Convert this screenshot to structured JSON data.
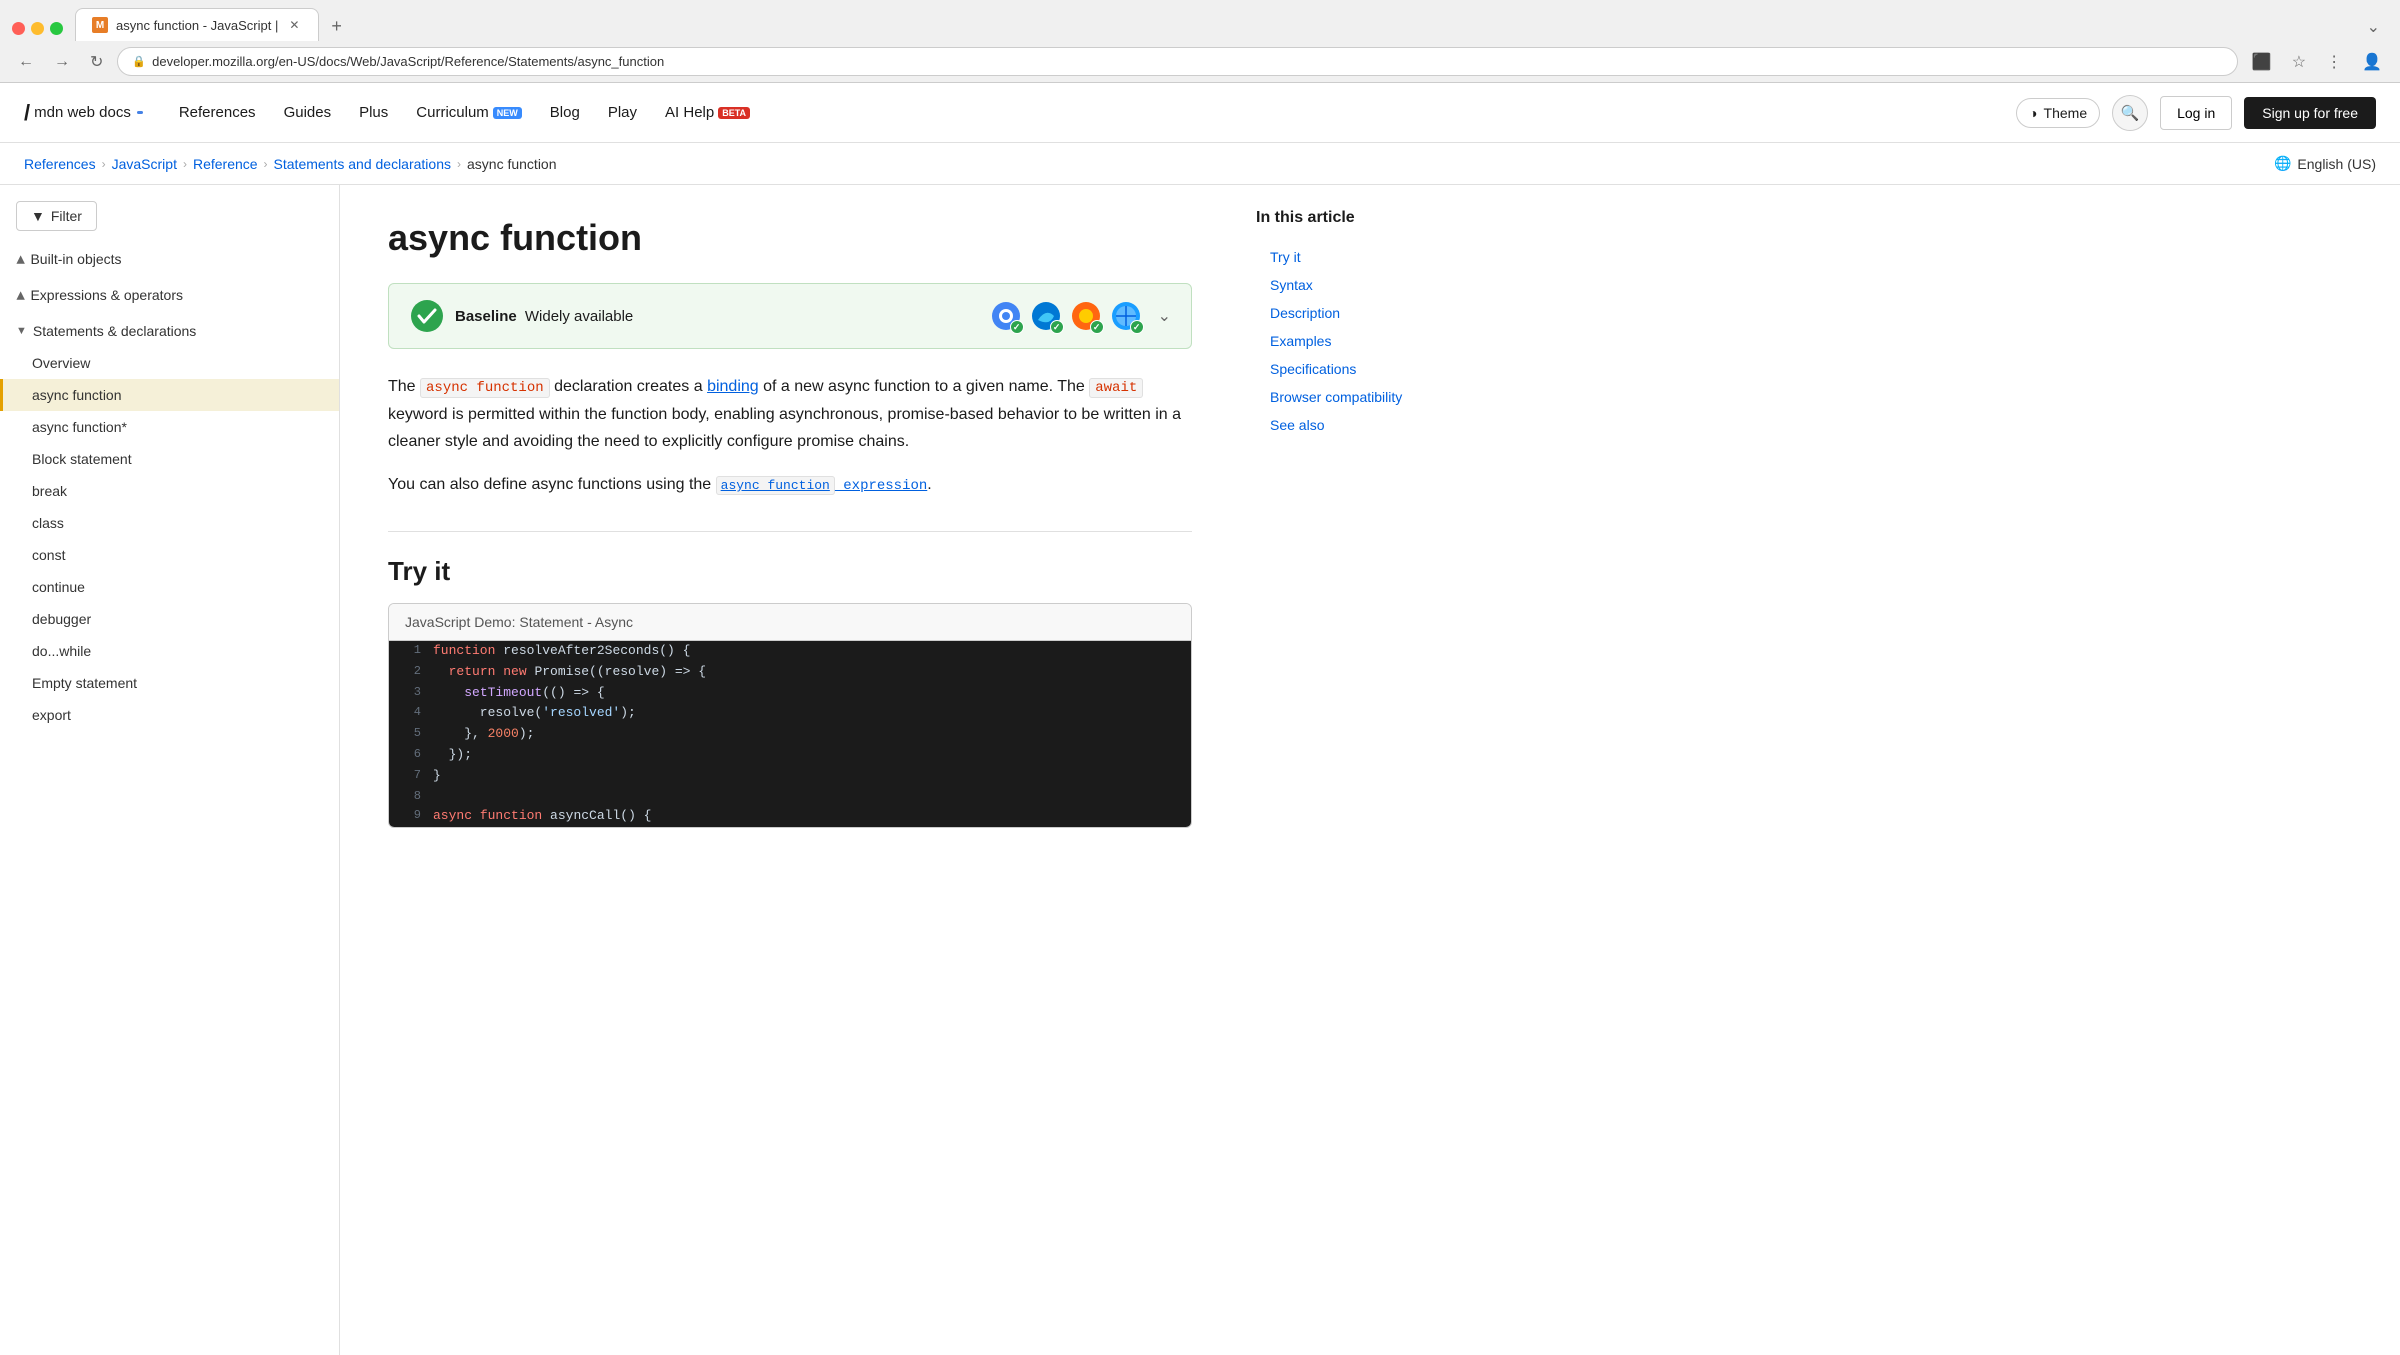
{
  "browser": {
    "tab_title": "async function - JavaScript |",
    "url": "developer.mozilla.org/en-US/docs/Web/JavaScript/Reference/Statements/async_function",
    "tab_favicon": "M"
  },
  "nav": {
    "logo_text": "mdn web docs",
    "links": [
      {
        "id": "references",
        "label": "References"
      },
      {
        "id": "guides",
        "label": "Guides"
      },
      {
        "id": "plus",
        "label": "Plus"
      },
      {
        "id": "curriculum",
        "label": "Curriculum",
        "badge": "NEW"
      },
      {
        "id": "blog",
        "label": "Blog"
      },
      {
        "id": "play",
        "label": "Play"
      },
      {
        "id": "ai-help",
        "label": "AI Help",
        "badge": "BETA"
      }
    ],
    "theme_label": "Theme",
    "login_label": "Log in",
    "signup_label": "Sign up for free"
  },
  "breadcrumb": {
    "items": [
      {
        "id": "references",
        "label": "References",
        "href": "#"
      },
      {
        "id": "javascript",
        "label": "JavaScript",
        "href": "#"
      },
      {
        "id": "reference",
        "label": "Reference",
        "href": "#"
      },
      {
        "id": "statements",
        "label": "Statements and declarations",
        "href": "#"
      },
      {
        "id": "current",
        "label": "async function"
      }
    ],
    "lang": "English (US)"
  },
  "sidebar": {
    "filter_label": "Filter",
    "sections": [
      {
        "id": "built-in-objects",
        "label": "Built-in objects",
        "collapsed": true
      },
      {
        "id": "expressions-operators",
        "label": "Expressions & operators",
        "collapsed": true
      },
      {
        "id": "statements-declarations",
        "label": "Statements & declarations",
        "collapsed": false,
        "items": [
          {
            "id": "overview",
            "label": "Overview"
          },
          {
            "id": "async-function",
            "label": "async function",
            "active": true
          },
          {
            "id": "async-function-gen",
            "label": "async function*"
          },
          {
            "id": "block-statement",
            "label": "Block statement"
          },
          {
            "id": "break",
            "label": "break"
          },
          {
            "id": "class",
            "label": "class"
          },
          {
            "id": "const",
            "label": "const"
          },
          {
            "id": "continue",
            "label": "continue"
          },
          {
            "id": "debugger",
            "label": "debugger"
          },
          {
            "id": "do-while",
            "label": "do...while"
          },
          {
            "id": "empty-statement",
            "label": "Empty statement"
          },
          {
            "id": "export",
            "label": "export"
          }
        ]
      }
    ]
  },
  "content": {
    "page_title": "async function",
    "baseline": {
      "check_icon": "✓",
      "title": "Baseline",
      "subtitle": "Widely available",
      "browsers": [
        {
          "name": "Chrome",
          "color": "#4285f4",
          "symbol": "●"
        },
        {
          "name": "Edge",
          "color": "#0078d4",
          "symbol": "●"
        },
        {
          "name": "Firefox",
          "color": "#ff6611",
          "symbol": "●"
        },
        {
          "name": "Safari",
          "color": "#1a9eff",
          "symbol": "●"
        }
      ]
    },
    "intro_paragraph_1": "The async function declaration creates a binding of a new async function to a given name. The await keyword is permitted within the function body, enabling asynchronous, promise-based behavior to be written in a cleaner style and avoiding the need to explicitly configure promise chains.",
    "binding_link": "binding",
    "intro_paragraph_2": "You can also define async functions using the",
    "async_expr_link": "async_function expression",
    "intro_end": ".",
    "try_it_section": {
      "heading": "Try it",
      "demo_header": "JavaScript Demo: Statement - Async",
      "code_lines": [
        {
          "num": 1,
          "text": "function resolveAfter2Seconds() {",
          "tokens": [
            {
              "t": "kw",
              "v": "function"
            },
            {
              "t": "plain",
              "v": " resolveAfter2Seconds() {"
            }
          ]
        },
        {
          "num": 2,
          "text": "  return new Promise((resolve) => {",
          "tokens": [
            {
              "t": "ws",
              "v": "  "
            },
            {
              "t": "kw",
              "v": "return"
            },
            {
              "t": "plain",
              "v": " "
            },
            {
              "t": "kw",
              "v": "new"
            },
            {
              "t": "plain",
              "v": " Promise((resolve) => {"
            }
          ]
        },
        {
          "num": 3,
          "text": "    setTimeout(() => {",
          "tokens": [
            {
              "t": "ws",
              "v": "    "
            },
            {
              "t": "fn",
              "v": "setTimeout"
            },
            {
              "t": "plain",
              "v": "(() => {"
            }
          ]
        },
        {
          "num": 4,
          "text": "      resolve('resolved');",
          "tokens": [
            {
              "t": "ws",
              "v": "      "
            },
            {
              "t": "plain",
              "v": "resolve("
            },
            {
              "t": "str",
              "v": "'resolved'"
            },
            {
              "t": "plain",
              "v": ");"
            }
          ]
        },
        {
          "num": 5,
          "text": "    }, 2000);",
          "tokens": [
            {
              "t": "ws",
              "v": "    "
            },
            {
              "t": "plain",
              "v": "}, "
            },
            {
              "t": "num",
              "v": "2000"
            },
            {
              "t": "plain",
              "v": ");"
            }
          ]
        },
        {
          "num": 6,
          "text": "  });",
          "tokens": [
            {
              "t": "ws",
              "v": "  "
            },
            {
              "t": "plain",
              "v": "});"
            }
          ]
        },
        {
          "num": 7,
          "text": "}",
          "tokens": [
            {
              "t": "plain",
              "v": "}"
            }
          ]
        },
        {
          "num": 8,
          "text": "",
          "tokens": []
        },
        {
          "num": 9,
          "text": "async function asyncCall() {",
          "tokens": [
            {
              "t": "kw",
              "v": "async"
            },
            {
              "t": "plain",
              "v": " "
            },
            {
              "t": "kw",
              "v": "function"
            },
            {
              "t": "plain",
              "v": " asyncCall() {"
            }
          ]
        }
      ]
    }
  },
  "toc": {
    "title": "In this article",
    "items": [
      {
        "id": "try-it",
        "label": "Try it"
      },
      {
        "id": "syntax",
        "label": "Syntax"
      },
      {
        "id": "description",
        "label": "Description"
      },
      {
        "id": "examples",
        "label": "Examples"
      },
      {
        "id": "specifications",
        "label": "Specifications"
      },
      {
        "id": "browser-compat",
        "label": "Browser compatibility"
      },
      {
        "id": "see-also",
        "label": "See also"
      }
    ]
  }
}
